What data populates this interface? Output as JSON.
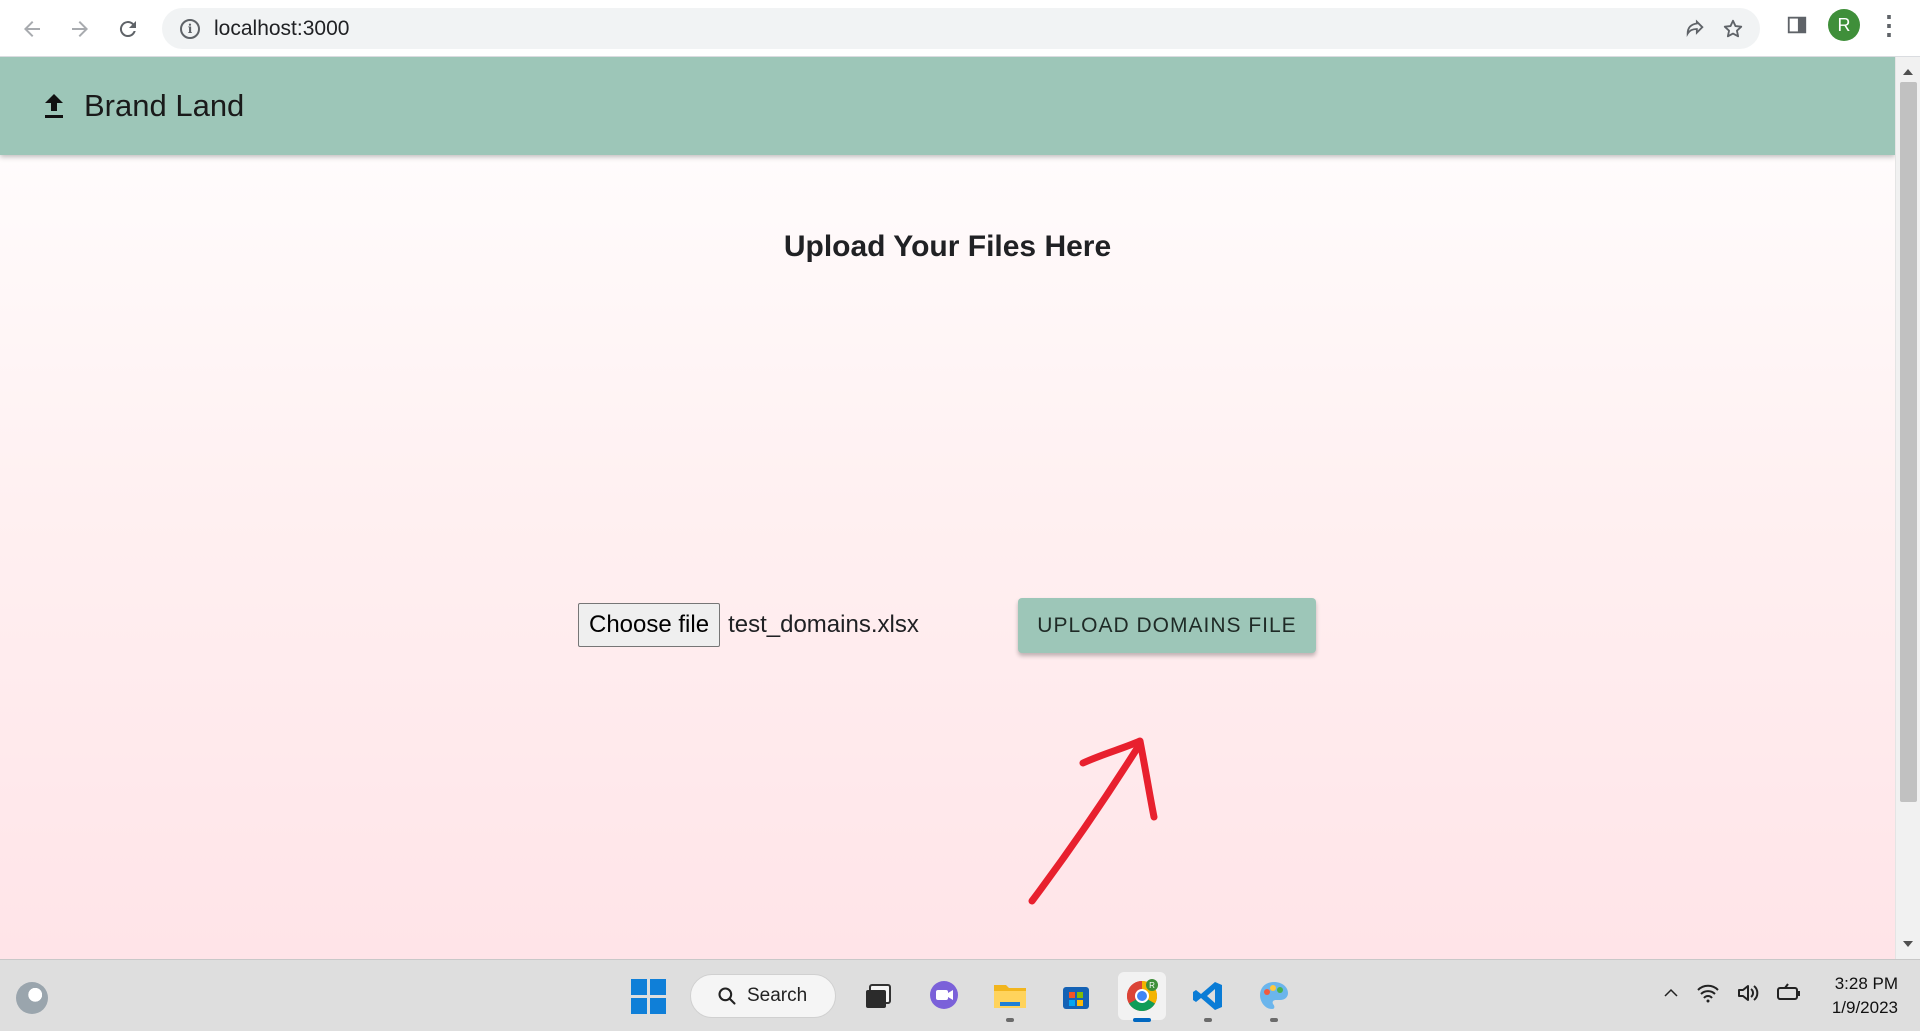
{
  "browser": {
    "url": "localhost:3000",
    "profile_initial": "R"
  },
  "app": {
    "brand": "Brand Land",
    "page_title": "Upload Your Files Here",
    "choose_file_label": "Choose file",
    "selected_file_name": "test_domains.xlsx",
    "upload_button_label": "UPLOAD DOMAINS FILE",
    "header_color": "#9dc6b8",
    "annotation_color": "#e8202e"
  },
  "taskbar": {
    "search_label": "Search",
    "chrome_badge": "R",
    "time": "3:28 PM",
    "date": "1/9/2023",
    "apps": [
      "start-icon",
      "task-view-icon",
      "teams-chat-icon",
      "file-explorer-icon",
      "store-icon",
      "chrome-icon",
      "vscode-icon",
      "paint-icon"
    ]
  }
}
